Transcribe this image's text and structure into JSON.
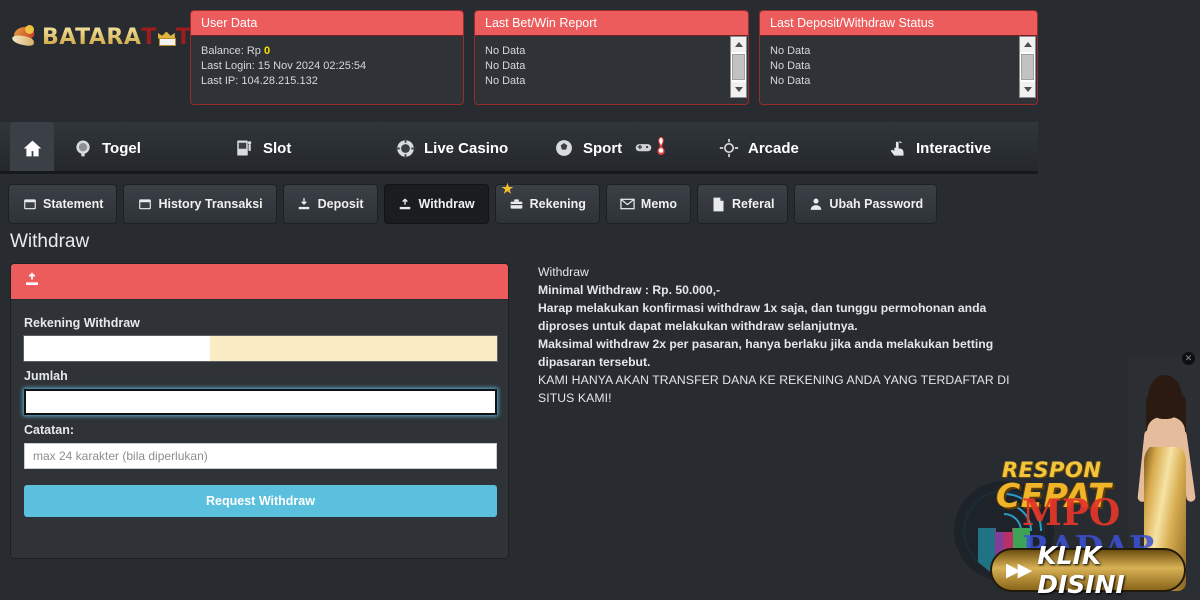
{
  "brand": {
    "name_gold_1": "BATARA",
    "name_red": "T",
    "name_red_2": "T",
    "crown_icon": "crown-icon",
    "bird_icon": "garuda-bird-icon"
  },
  "panels": [
    {
      "title": "User Data",
      "lines": [
        "Balance: Rp ",
        "Last Login: 15 Nov 2024 02:25:54",
        "Last IP: 104.28.215.132"
      ],
      "balance_label": "Balance: Rp",
      "balance_value": "0",
      "last_login": "Last Login: 15 Nov 2024 02:25:54",
      "last_ip": "Last IP: 104.28.215.132"
    },
    {
      "title": "Last Bet/Win Report",
      "rows": [
        "No Data",
        "No Data",
        "No Data"
      ]
    },
    {
      "title": "Last Deposit/Withdraw Status",
      "rows": [
        "No Data",
        "No Data",
        "No Data"
      ]
    }
  ],
  "mainnav": {
    "home_label": "Home",
    "items": [
      {
        "label": "Togel",
        "icon": "lottery-ball-icon"
      },
      {
        "label": "Slot",
        "icon": "slot-machine-icon"
      },
      {
        "label": "Live Casino",
        "icon": "casino-chip-icon"
      },
      {
        "label": "Sport",
        "icon": "soccer-ball-icon"
      },
      {
        "label": "Arcade",
        "icon": "arcade-target-icon"
      },
      {
        "label": "Interactive",
        "icon": "hand-tap-icon"
      }
    ],
    "sport_badges": [
      "gamepad-icon",
      "bowling-pin-icon"
    ]
  },
  "subtabs": [
    {
      "label": "Statement",
      "icon": "calendar-icon",
      "active": false,
      "star": false
    },
    {
      "label": "History Transaksi",
      "icon": "calendar-icon",
      "active": false,
      "star": false
    },
    {
      "label": "Deposit",
      "icon": "deposit-arrow-icon",
      "active": false,
      "star": false
    },
    {
      "label": "Withdraw",
      "icon": "withdraw-arrow-icon",
      "active": true,
      "star": false
    },
    {
      "label": "Rekening",
      "icon": "bank-icon",
      "active": false,
      "star": true
    },
    {
      "label": "Memo",
      "icon": "envelope-icon",
      "active": false,
      "star": false
    },
    {
      "label": "Referal",
      "icon": "document-icon",
      "active": false,
      "star": false
    },
    {
      "label": "Ubah Password",
      "icon": "user-icon",
      "active": false,
      "star": false
    }
  ],
  "page": {
    "title": "Withdraw"
  },
  "form": {
    "header_icon": "withdraw-arrow-icon",
    "rekening_label": "Rekening Withdraw",
    "rekening_value": "",
    "jumlah_label": "Jumlah",
    "jumlah_value": "",
    "catatan_label": "Catatan:",
    "catatan_placeholder": "max 24 karakter (bila diperlukan)",
    "catatan_value": "",
    "submit_label": "Request Withdraw",
    "submit_color": "#5bc0de"
  },
  "info": {
    "line1": "Withdraw",
    "line2": "Minimal Withdraw : Rp. 50.000,-",
    "line3": "Harap melakukan konfirmasi withdraw 1x saja, dan tunggu permohonan anda diproses untuk dapat melakukan withdraw selanjutnya.",
    "line4": "Maksimal withdraw 2x per pasaran, hanya berlaku jika anda melakukan betting dipasaran tersebut.",
    "line5": "KAMI HANYA AKAN TRANSFER DANA KE REKENING ANDA YANG TERDAFTAR DI SITUS KAMI!"
  },
  "ad": {
    "close_label": "✕",
    "respon": "RESPON",
    "cepat": "CEPAT",
    "overlay_top": "MPO",
    "overlay_bottom": "RADAR",
    "cta_arrows": "▶▶",
    "cta_label": "KLIK DISINI",
    "watermark_icon": "mpo-radar-shield-logo"
  },
  "colors": {
    "page_bg": "#282c30",
    "panel_bg": "#2f3337",
    "accent_red": "#ed5c5c",
    "accent_blue": "#5bc0de",
    "gold": "#f2c12e",
    "balance_yellow": "#ffe400"
  }
}
